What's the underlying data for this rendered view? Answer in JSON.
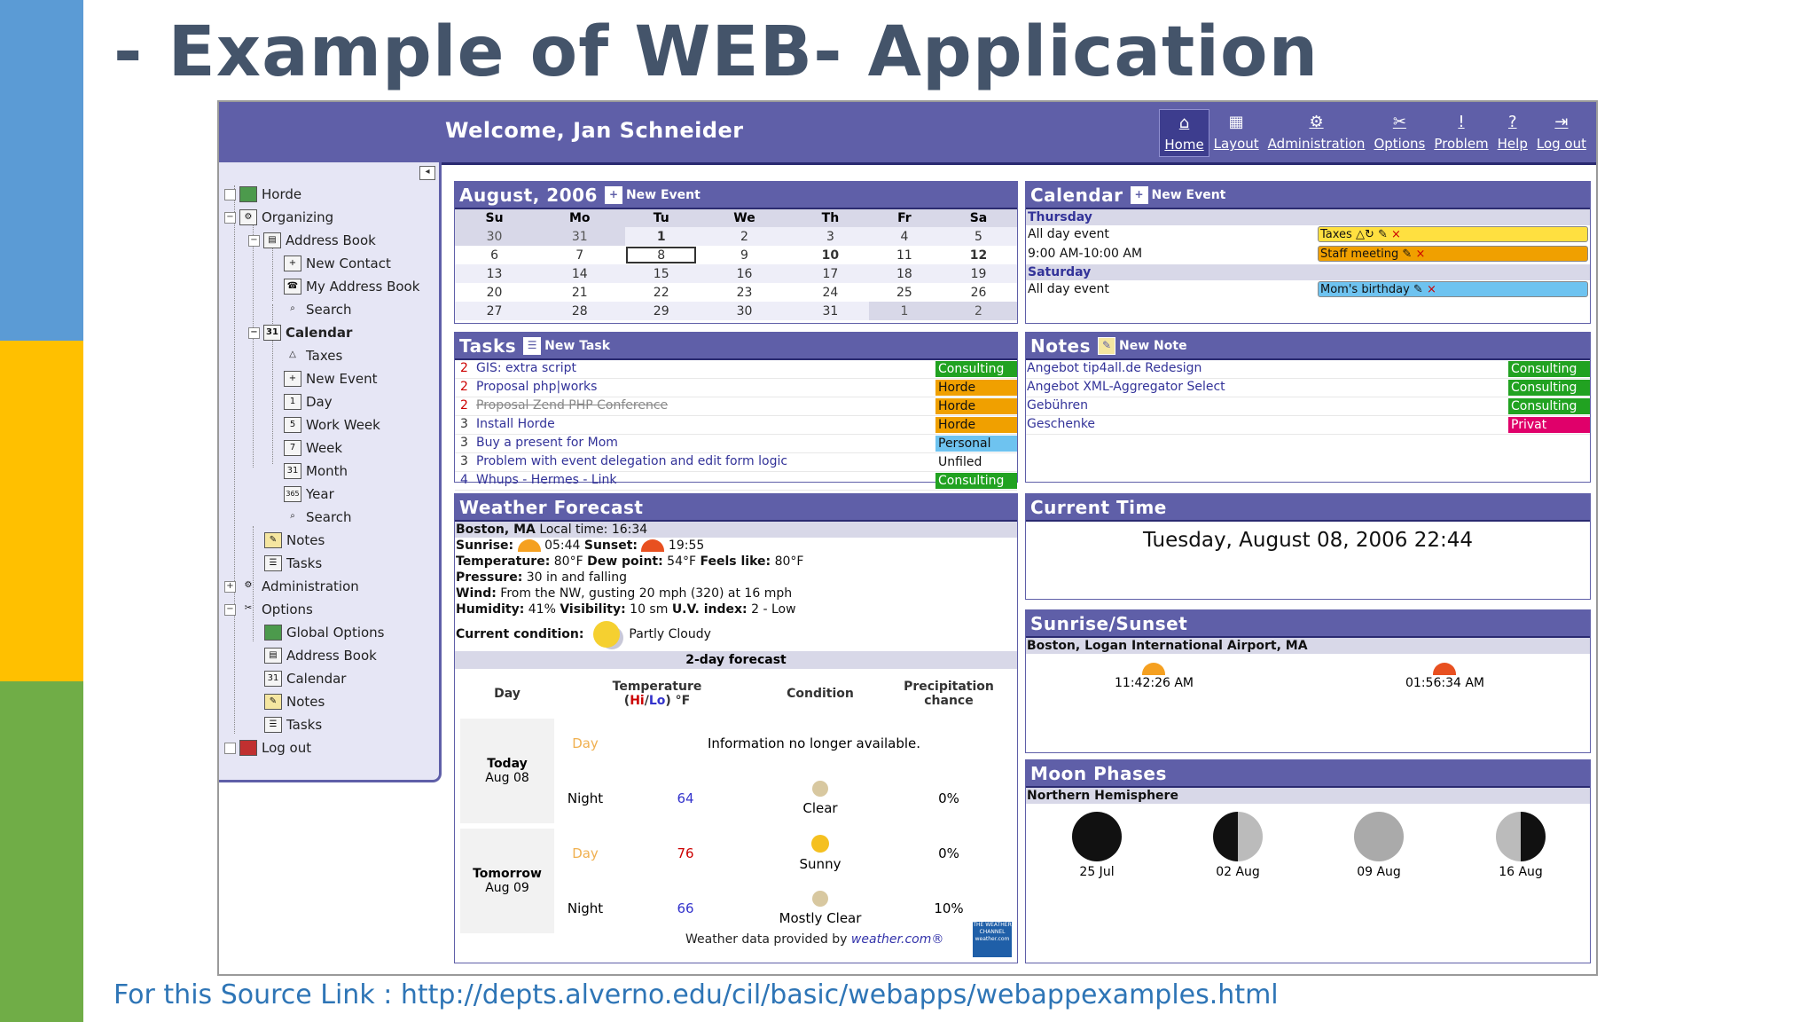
{
  "slide": {
    "title": "- Example of WEB- Application",
    "source_label": "For this Source Link :",
    "source_url": "http://depts.alverno.edu/cil/basic/webapps/webappexamples.html"
  },
  "app": {
    "welcome": "Welcome, Jan Schneider",
    "nav": [
      {
        "label": "Home",
        "icon": "home-icon"
      },
      {
        "label": "Layout",
        "icon": "layout-icon"
      },
      {
        "label": "Administration",
        "icon": "admin-icon"
      },
      {
        "label": "Options",
        "icon": "options-icon"
      },
      {
        "label": "Problem",
        "icon": "problem-icon"
      },
      {
        "label": "Help",
        "icon": "help-icon"
      },
      {
        "label": "Log out",
        "icon": "logout-icon"
      }
    ]
  },
  "sidebar": {
    "items": [
      {
        "label": "Horde"
      },
      {
        "label": "Organizing"
      },
      {
        "label": "Address Book"
      },
      {
        "label": "New Contact"
      },
      {
        "label": "My Address Book"
      },
      {
        "label": "Search"
      },
      {
        "label": "Calendar"
      },
      {
        "label": "Taxes"
      },
      {
        "label": "New Event"
      },
      {
        "label": "Day"
      },
      {
        "label": "Work Week"
      },
      {
        "label": "Week"
      },
      {
        "label": "Month"
      },
      {
        "label": "Year"
      },
      {
        "label": "Search"
      },
      {
        "label": "Notes"
      },
      {
        "label": "Tasks"
      },
      {
        "label": "Administration"
      },
      {
        "label": "Options"
      },
      {
        "label": "Global Options"
      },
      {
        "label": "Address Book"
      },
      {
        "label": "Calendar"
      },
      {
        "label": "Notes"
      },
      {
        "label": "Tasks"
      },
      {
        "label": "Log out"
      }
    ],
    "icon_text": {
      "day": "1",
      "workweek": "5",
      "week": "7",
      "month": "31",
      "year": "365",
      "cal": "31"
    }
  },
  "month_cal": {
    "title": "August, 2006",
    "new_event": "New Event",
    "days": [
      "Su",
      "Mo",
      "Tu",
      "We",
      "Th",
      "Fr",
      "Sa"
    ],
    "weeks": [
      [
        "30",
        "31",
        "1",
        "2",
        "3",
        "4",
        "5"
      ],
      [
        "6",
        "7",
        "8",
        "9",
        "10",
        "11",
        "12"
      ],
      [
        "13",
        "14",
        "15",
        "16",
        "17",
        "18",
        "19"
      ],
      [
        "20",
        "21",
        "22",
        "23",
        "24",
        "25",
        "26"
      ],
      [
        "27",
        "28",
        "29",
        "30",
        "31",
        "1",
        "2"
      ]
    ]
  },
  "calendar": {
    "title": "Calendar",
    "new_event": "New Event",
    "day1": "Thursday",
    "ev1": "All day event",
    "ev1_tag": "Taxes",
    "ev2": "9:00 AM-10:00 AM",
    "ev2_tag": "Staff meeting",
    "day2": "Saturday",
    "ev3": "All day event",
    "ev3_tag": "Mom's birthday"
  },
  "tasks": {
    "title": "Tasks",
    "new_task": "New Task",
    "rows": [
      {
        "p": "2",
        "name": "GIS: extra script",
        "cat": "Consulting"
      },
      {
        "p": "2",
        "name": "Proposal php|works",
        "cat": "Horde"
      },
      {
        "p": "2",
        "name": "Proposal Zend PHP Conference",
        "cat": "Horde"
      },
      {
        "p": "3",
        "name": "Install Horde",
        "cat": "Horde"
      },
      {
        "p": "3",
        "name": "Buy a present for Mom",
        "cat": "Personal"
      },
      {
        "p": "3",
        "name": "Problem with event delegation and edit form logic",
        "cat": "Unfiled"
      },
      {
        "p": "4",
        "name": "Whups - Hermes - Link",
        "cat": "Consulting"
      }
    ]
  },
  "notes": {
    "title": "Notes",
    "new_note": "New Note",
    "rows": [
      {
        "name": "Angebot tip4all.de Redesign",
        "cat": "Consulting"
      },
      {
        "name": "Angebot XML-Aggregator Select",
        "cat": "Consulting"
      },
      {
        "name": "Gebühren",
        "cat": "Consulting"
      },
      {
        "name": "Geschenke",
        "cat": "Privat"
      }
    ]
  },
  "weather": {
    "title": "Weather Forecast",
    "loc_city": "Boston, MA",
    "loc_time": "Local time: 16:34",
    "sunrise_label": "Sunrise:",
    "sunrise": "05:44",
    "sunset_label": "Sunset:",
    "sunset": "19:55",
    "temp_label": "Temperature:",
    "temp": "80°F",
    "dew_label": "Dew point:",
    "dew": "54°F",
    "feels_label": "Feels like:",
    "feels": "80°F",
    "pressure_label": "Pressure:",
    "pressure": "30 in and falling",
    "wind_label": "Wind:",
    "wind": "From the NW, gusting 20 mph (320) at 16 mph",
    "humidity_label": "Humidity:",
    "humidity": "41%",
    "visibility_label": "Visibility:",
    "visibility": "10 sm",
    "uv_label": "U.V. index:",
    "uv": "2 - Low",
    "cond_label": "Current condition:",
    "cond": "Partly Cloudy",
    "forecast_title": "2-day forecast",
    "col_day": "Day",
    "col_temp1": "Temperature",
    "col_hi": "Hi",
    "col_slash": "/",
    "col_lo": "Lo",
    "col_unit": ") °F",
    "col_cond": "Condition",
    "col_precip": "Precipitation chance",
    "today_label": "Today",
    "today_date": "Aug 08",
    "tomorrow_label": "Tomorrow",
    "tomorrow_date": "Aug 09",
    "day_word": "Day",
    "night_word": "Night",
    "na": "Information no longer available.",
    "t_night_temp": "64",
    "t_night_cond": "Clear",
    "t_night_precip": "0%",
    "tm_day_temp": "76",
    "tm_day_cond": "Sunny",
    "tm_day_precip": "0%",
    "tm_night_temp": "66",
    "tm_night_cond": "Mostly Clear",
    "tm_night_precip": "10%",
    "credit": "Weather data provided by",
    "credit_link": "weather.com®",
    "logo_text": "THE WEATHER CHANNEL",
    "logo_sub": "weather.com"
  },
  "current_time": {
    "title": "Current Time",
    "value": "Tuesday, August 08, 2006 22:44"
  },
  "sunrise_sunset": {
    "title": "Sunrise/Sunset",
    "location": "Boston, Logan International Airport, MA",
    "sunrise": "11:42:26 AM",
    "sunset": "01:56:34 AM"
  },
  "moon": {
    "title": "Moon Phases",
    "hemisphere": "Northern Hemisphere",
    "phases": [
      {
        "date": "25 Jul"
      },
      {
        "date": "02 Aug"
      },
      {
        "date": "09 Aug"
      },
      {
        "date": "16 Aug"
      }
    ]
  },
  "colors": {
    "header": "#5f5fa8",
    "slide_title": "#44546a",
    "link": "#2e75b6"
  }
}
